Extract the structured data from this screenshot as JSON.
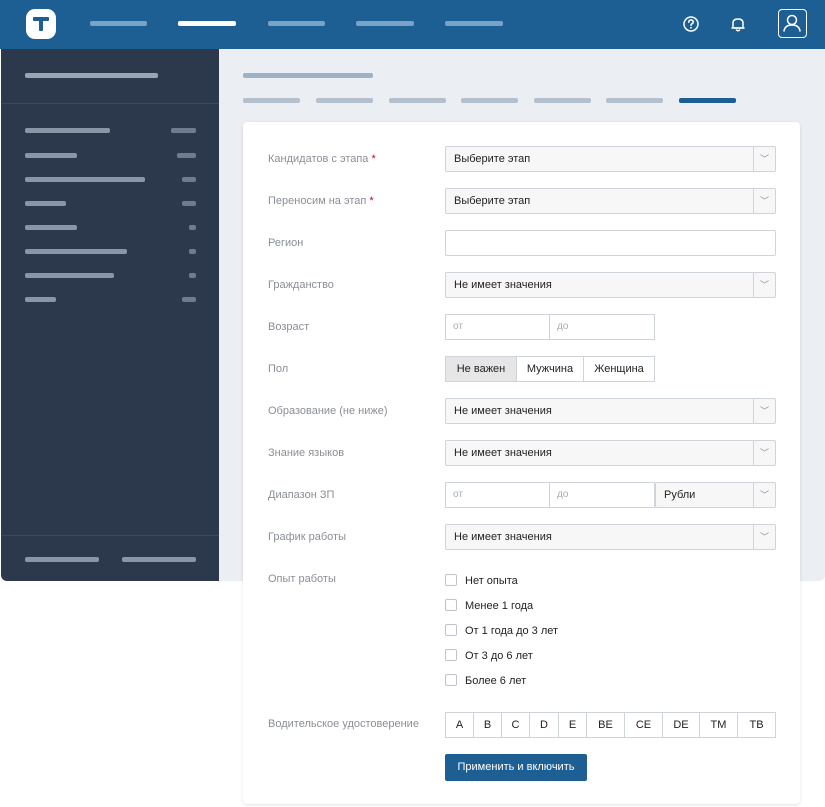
{
  "form": {
    "candidates_stage": {
      "label": "Кандидатов с этапа",
      "required_mark": "*",
      "value": "Выберите этап"
    },
    "move_to_stage": {
      "label": "Переносим на этап",
      "required_mark": "*",
      "value": "Выберите этап"
    },
    "region": {
      "label": "Регион",
      "value": ""
    },
    "citizenship": {
      "label": "Гражданство",
      "value": "Не имеет значения"
    },
    "age": {
      "label": "Возраст",
      "from_placeholder": "от",
      "to_placeholder": "до"
    },
    "gender": {
      "label": "Пол",
      "options": [
        "Не важен",
        "Мужчина",
        "Женщина"
      ],
      "selected": "Не важен"
    },
    "education": {
      "label": "Образование (не ниже)",
      "value": "Не имеет значения"
    },
    "languages": {
      "label": "Знание языков",
      "value": "Не имеет значения"
    },
    "salary": {
      "label": "Диапазон ЗП",
      "from_placeholder": "от",
      "to_placeholder": "до",
      "currency": "Рубли"
    },
    "schedule": {
      "label": "График работы",
      "value": "Не имеет значения"
    },
    "experience": {
      "label": "Опыт работы",
      "options": [
        "Нет опыта",
        "Менее 1 года",
        "От 1 года до 3 лет",
        "От 3 до 6 лет",
        "Более 6 лет"
      ]
    },
    "license": {
      "label": "Водительское удостоверение",
      "categories": [
        "A",
        "B",
        "C",
        "D",
        "E",
        "BE",
        "CE",
        "DE",
        "TM",
        "TB"
      ]
    },
    "apply_label": "Применить и включить"
  },
  "icons": {
    "help": "question-circle-icon",
    "notifications": "bell-icon",
    "user": "user-icon",
    "dropdown": "chevron-down-icon"
  },
  "colors": {
    "primary": "#1e5f93",
    "sidebar": "#2c394c",
    "required": "#d0021b"
  }
}
